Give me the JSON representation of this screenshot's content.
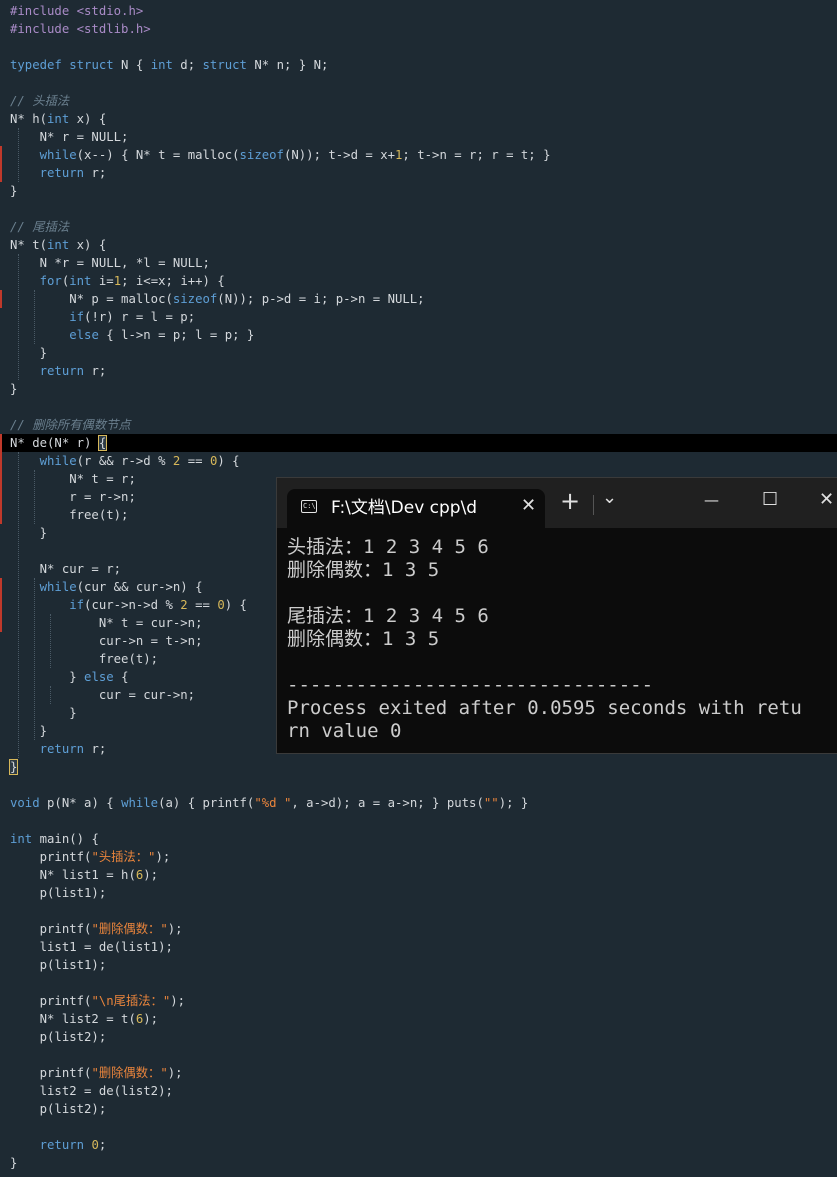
{
  "editor": {
    "lines": [
      [
        [
          "#include <stdio.h>",
          "pre"
        ]
      ],
      [
        [
          "#include <stdlib.h>",
          "pre"
        ]
      ],
      [],
      [
        [
          "typedef",
          "kw"
        ],
        [
          " ",
          ""
        ],
        [
          "struct",
          "kw"
        ],
        [
          " N { ",
          ""
        ],
        [
          "int",
          "kw"
        ],
        [
          " d; ",
          ""
        ],
        [
          "struct",
          "kw"
        ],
        [
          " N* n; } N;",
          ""
        ]
      ],
      [],
      [
        [
          "// 头插法",
          "com"
        ]
      ],
      [
        [
          "N* h(",
          ""
        ],
        [
          "int",
          "kw"
        ],
        [
          " x) {",
          ""
        ]
      ],
      [
        [
          "    N* r = NULL;",
          ""
        ]
      ],
      [
        [
          "    ",
          ""
        ],
        [
          "while",
          "kw"
        ],
        [
          "(x--) { N* t = malloc(",
          ""
        ],
        [
          "sizeof",
          "kw"
        ],
        [
          "(N)); t->d = x+",
          ""
        ],
        [
          "1",
          "num"
        ],
        [
          "; t->n = r; r = t; }",
          ""
        ]
      ],
      [
        [
          "    ",
          ""
        ],
        [
          "return",
          "kw"
        ],
        [
          " r;",
          ""
        ]
      ],
      [
        [
          "}",
          ""
        ]
      ],
      [],
      [
        [
          "// 尾插法",
          "com"
        ]
      ],
      [
        [
          "N* t(",
          ""
        ],
        [
          "int",
          "kw"
        ],
        [
          " x) {",
          ""
        ]
      ],
      [
        [
          "    N *r = NULL, *l = NULL;",
          ""
        ]
      ],
      [
        [
          "    ",
          ""
        ],
        [
          "for",
          "kw"
        ],
        [
          "(",
          ""
        ],
        [
          "int",
          "kw"
        ],
        [
          " i=",
          ""
        ],
        [
          "1",
          "num"
        ],
        [
          "; i<=x; i++) {",
          ""
        ]
      ],
      [
        [
          "        N* p = malloc(",
          ""
        ],
        [
          "sizeof",
          "kw"
        ],
        [
          "(N)); p->d = i; p->n = NULL;",
          ""
        ]
      ],
      [
        [
          "        ",
          ""
        ],
        [
          "if",
          "kw"
        ],
        [
          "(!r) r = l = p;",
          ""
        ]
      ],
      [
        [
          "        ",
          ""
        ],
        [
          "else",
          "kw"
        ],
        [
          " { l->n = p; l = p; }",
          ""
        ]
      ],
      [
        [
          "    }",
          ""
        ]
      ],
      [
        [
          "    ",
          ""
        ],
        [
          "return",
          "kw"
        ],
        [
          " r;",
          ""
        ]
      ],
      [
        [
          "}",
          ""
        ]
      ],
      [],
      [
        [
          "// 删除所有偶数节点",
          "com"
        ]
      ],
      [
        [
          "N* de(N* r) ",
          ""
        ],
        [
          "{",
          "br"
        ]
      ],
      [
        [
          "    ",
          ""
        ],
        [
          "while",
          "kw"
        ],
        [
          "(r && r->d % ",
          ""
        ],
        [
          "2",
          "num"
        ],
        [
          " == ",
          ""
        ],
        [
          "0",
          "num"
        ],
        [
          ") {",
          ""
        ]
      ],
      [
        [
          "        N* t = r;",
          ""
        ]
      ],
      [
        [
          "        r = r->n;",
          ""
        ]
      ],
      [
        [
          "        free(t);",
          ""
        ]
      ],
      [
        [
          "    }",
          ""
        ]
      ],
      [],
      [
        [
          "    N* cur = r;",
          ""
        ]
      ],
      [
        [
          "    ",
          ""
        ],
        [
          "while",
          "kw"
        ],
        [
          "(cur && cur->n) {",
          ""
        ]
      ],
      [
        [
          "        ",
          ""
        ],
        [
          "if",
          "kw"
        ],
        [
          "(cur->n->d % ",
          ""
        ],
        [
          "2",
          "num"
        ],
        [
          " == ",
          ""
        ],
        [
          "0",
          "num"
        ],
        [
          ") {",
          ""
        ]
      ],
      [
        [
          "            N* t = cur->n;",
          ""
        ]
      ],
      [
        [
          "            cur->n = t->n;",
          ""
        ]
      ],
      [
        [
          "            free(t);",
          ""
        ]
      ],
      [
        [
          "        } ",
          ""
        ],
        [
          "else",
          "kw"
        ],
        [
          " {",
          ""
        ]
      ],
      [
        [
          "            cur = cur->n;",
          ""
        ]
      ],
      [
        [
          "        }",
          ""
        ]
      ],
      [
        [
          "    }",
          ""
        ]
      ],
      [
        [
          "    ",
          ""
        ],
        [
          "return",
          "kw"
        ],
        [
          " r;",
          ""
        ]
      ],
      [
        [
          "}",
          "br"
        ]
      ],
      [],
      [
        [
          "void",
          "kw"
        ],
        [
          " p(N* a) { ",
          ""
        ],
        [
          "while",
          "kw"
        ],
        [
          "(a) { printf(",
          ""
        ],
        [
          "\"%d \"",
          "str"
        ],
        [
          ", a->d); a = a->n; } puts(",
          ""
        ],
        [
          "\"\"",
          "str"
        ],
        [
          "); }",
          ""
        ]
      ],
      [],
      [
        [
          "int",
          "kw"
        ],
        [
          " main() {",
          ""
        ]
      ],
      [
        [
          "    printf(",
          ""
        ],
        [
          "\"头插法：\"",
          "str"
        ],
        [
          ");",
          ""
        ]
      ],
      [
        [
          "    N* list1 = h(",
          ""
        ],
        [
          "6",
          "num"
        ],
        [
          ");",
          ""
        ]
      ],
      [
        [
          "    p(list1);",
          ""
        ]
      ],
      [],
      [
        [
          "    printf(",
          ""
        ],
        [
          "\"删除偶数：\"",
          "str"
        ],
        [
          ");",
          ""
        ]
      ],
      [
        [
          "    list1 = de(list1);",
          ""
        ]
      ],
      [
        [
          "    p(list1);",
          ""
        ]
      ],
      [],
      [
        [
          "    printf(",
          ""
        ],
        [
          "\"\\n尾插法：\"",
          "str"
        ],
        [
          ");",
          ""
        ]
      ],
      [
        [
          "    N* list2 = t(",
          ""
        ],
        [
          "6",
          "num"
        ],
        [
          ");",
          ""
        ]
      ],
      [
        [
          "    p(list2);",
          ""
        ]
      ],
      [],
      [
        [
          "    printf(",
          ""
        ],
        [
          "\"删除偶数：\"",
          "str"
        ],
        [
          ");",
          ""
        ]
      ],
      [
        [
          "    list2 = de(list2);",
          ""
        ]
      ],
      [
        [
          "    p(list2);",
          ""
        ]
      ],
      [],
      [
        [
          "    ",
          ""
        ],
        [
          "return",
          "kw"
        ],
        [
          " ",
          ""
        ],
        [
          "0",
          "num"
        ],
        [
          ";",
          ""
        ]
      ],
      [
        [
          "}",
          ""
        ]
      ]
    ],
    "current_line": 24
  },
  "terminal": {
    "tab_title": "F:\\文档\\Dev cpp\\d",
    "tab_icon_text": "C:\\",
    "tab_close": "✕",
    "new_tab": "+",
    "dropdown": "⌄",
    "minimize": "—",
    "maximize": "☐",
    "close": "✕",
    "output": "头插法：1 2 3 4 5 6\n删除偶数：1 3 5\n\n尾插法：1 2 3 4 5 6\n删除偶数：1 3 5\n\n--------------------------------\nProcess exited after 0.0595 seconds with retu\nrn value 0"
  },
  "colors": {
    "editor_bg": "#1e2a33",
    "keyword": "#5e9fd6",
    "string": "#e8843c",
    "number": "#d7b85a",
    "preprocessor": "#a98bc7",
    "comment": "#6a7f8e",
    "terminal_bg": "#0c0c0c"
  }
}
